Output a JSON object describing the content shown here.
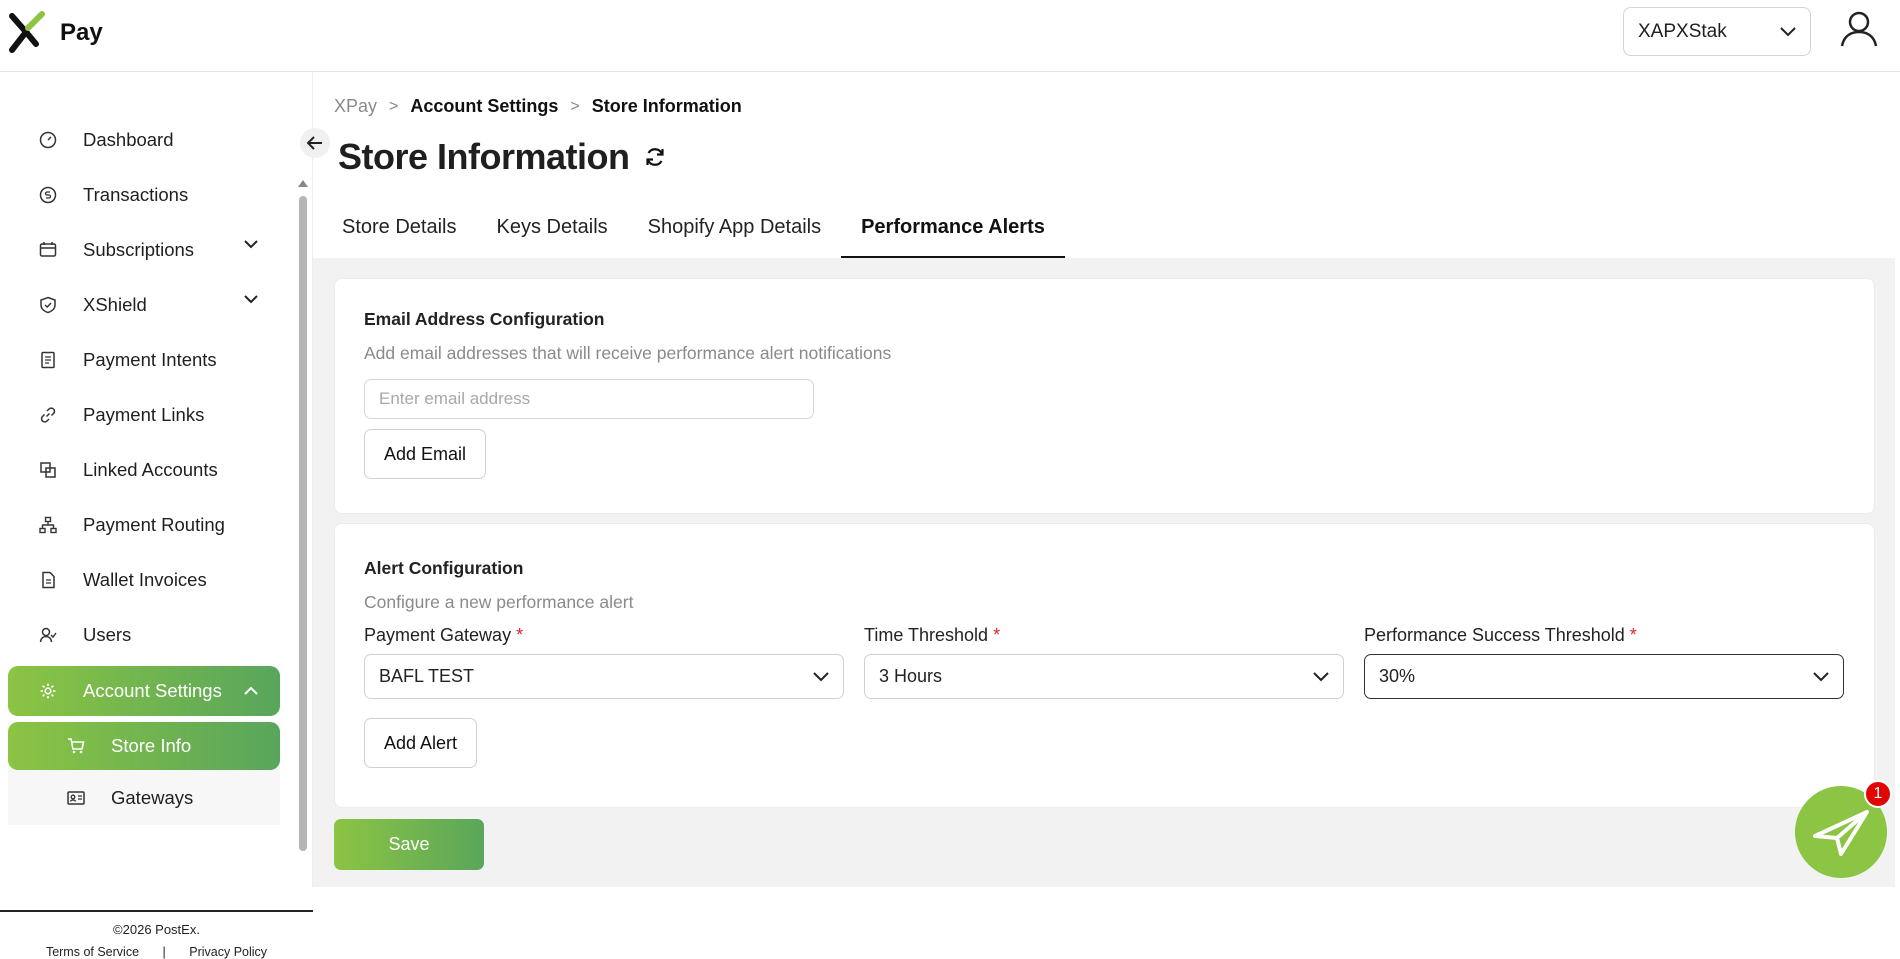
{
  "app": {
    "logo_text": "Pay",
    "brand_color": "#8cc443"
  },
  "header": {
    "store_selector": "XAPXStak"
  },
  "sidebar": {
    "items": [
      {
        "label": "Dashboard",
        "icon": "gauge-icon"
      },
      {
        "label": "Transactions",
        "icon": "currency-icon"
      },
      {
        "label": "Subscriptions",
        "icon": "calendar-icon",
        "expandable": true
      },
      {
        "label": "XShield",
        "icon": "shield-icon",
        "expandable": true
      },
      {
        "label": "Payment Intents",
        "icon": "document-icon"
      },
      {
        "label": "Payment Links",
        "icon": "link-icon"
      },
      {
        "label": "Linked Accounts",
        "icon": "copy-icon"
      },
      {
        "label": "Payment Routing",
        "icon": "network-icon"
      },
      {
        "label": "Wallet Invoices",
        "icon": "invoice-icon"
      },
      {
        "label": "Users",
        "icon": "users-icon"
      },
      {
        "label": "Account Settings",
        "icon": "gear-icon",
        "expanded": true,
        "active": true
      }
    ],
    "sub_items": [
      {
        "label": "Store Info",
        "icon": "cart-icon",
        "active": true
      },
      {
        "label": "Gateways",
        "icon": "id-card-icon"
      }
    ],
    "footer": {
      "copyright": "©2026 PostEx.",
      "terms": "Terms of Service",
      "divider": "|",
      "privacy": "Privacy Policy"
    }
  },
  "breadcrumb": {
    "items": [
      "XPay",
      "Account Settings",
      "Store Information"
    ],
    "separator": ">"
  },
  "page": {
    "title": "Store Information"
  },
  "tabs": [
    {
      "label": "Store Details",
      "active": false
    },
    {
      "label": "Keys Details",
      "active": false
    },
    {
      "label": "Shopify App Details",
      "active": false
    },
    {
      "label": "Performance Alerts",
      "active": true
    }
  ],
  "email_config": {
    "title": "Email Address Configuration",
    "subtitle": "Add email addresses that will receive performance alert notifications",
    "input_placeholder": "Enter email address",
    "input_value": "",
    "add_button": "Add Email"
  },
  "alert_config": {
    "title": "Alert Configuration",
    "subtitle": "Configure a new performance alert",
    "required_mark": "*",
    "fields": {
      "gateway": {
        "label": "Payment Gateway",
        "value": "BAFL TEST"
      },
      "time": {
        "label": "Time Threshold",
        "value": "3 Hours"
      },
      "success": {
        "label": "Performance Success Threshold",
        "value": "30%"
      }
    },
    "add_button": "Add Alert"
  },
  "save_button": "Save",
  "chat": {
    "badge_count": "1"
  }
}
